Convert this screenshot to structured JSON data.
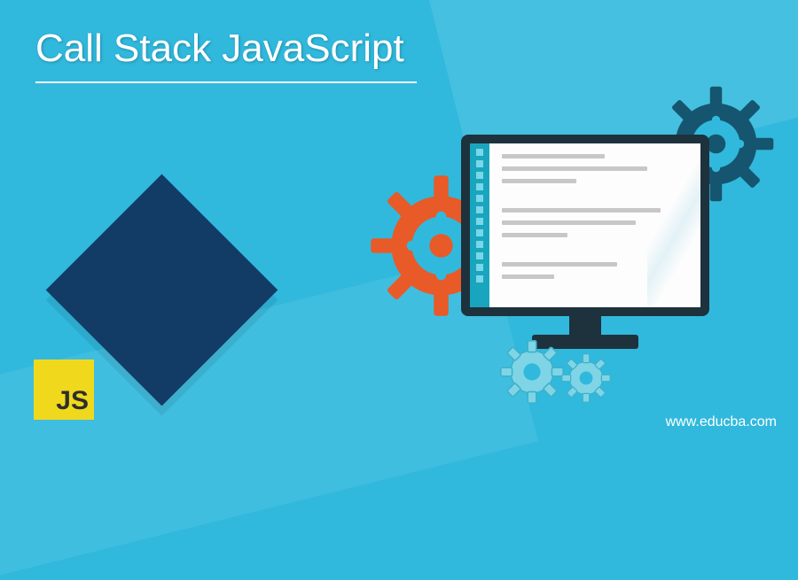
{
  "title": "Call Stack JavaScript",
  "logo_text": "JS",
  "website": "www.educba.com",
  "colors": {
    "background": "#30b9dd",
    "diamond": "#123b66",
    "js_logo_bg": "#f0d91d",
    "gear_orange": "#e85a28",
    "gear_darkblue": "#16556f",
    "gear_small": "#7fd5e6",
    "monitor_frame": "#1d323d",
    "screen_sidebar": "#1aa5bf"
  },
  "icons": {
    "gear_orange": "gear-icon",
    "gear_darkblue": "gear-icon",
    "gear_small1": "gear-icon",
    "gear_small2": "gear-icon",
    "monitor": "monitor-icon",
    "js_logo": "javascript-logo-icon"
  }
}
